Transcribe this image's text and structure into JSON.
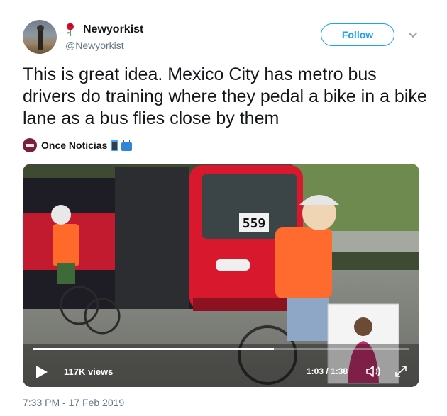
{
  "author": {
    "display_name": "Newyorkist",
    "handle": "@Newyorkist",
    "name_icon": "rose-icon"
  },
  "follow_button": {
    "label": "Follow"
  },
  "tweet": {
    "text": "This is great idea. Mexico City has metro bus drivers do training where they pedal a bike in a bike lane as a bus flies close by them",
    "timestamp": "7:33 PM - 17 Feb 2019"
  },
  "source": {
    "name": "Once Noticias",
    "icons": [
      "mobile-phone-icon",
      "television-icon"
    ]
  },
  "video": {
    "views": "117K views",
    "time": "1:03 / 1:38",
    "progress_fraction": 0.64,
    "bus_number": "559"
  },
  "colors": {
    "accent": "#1da1f2",
    "text": "#14171a",
    "muted": "#657786"
  }
}
